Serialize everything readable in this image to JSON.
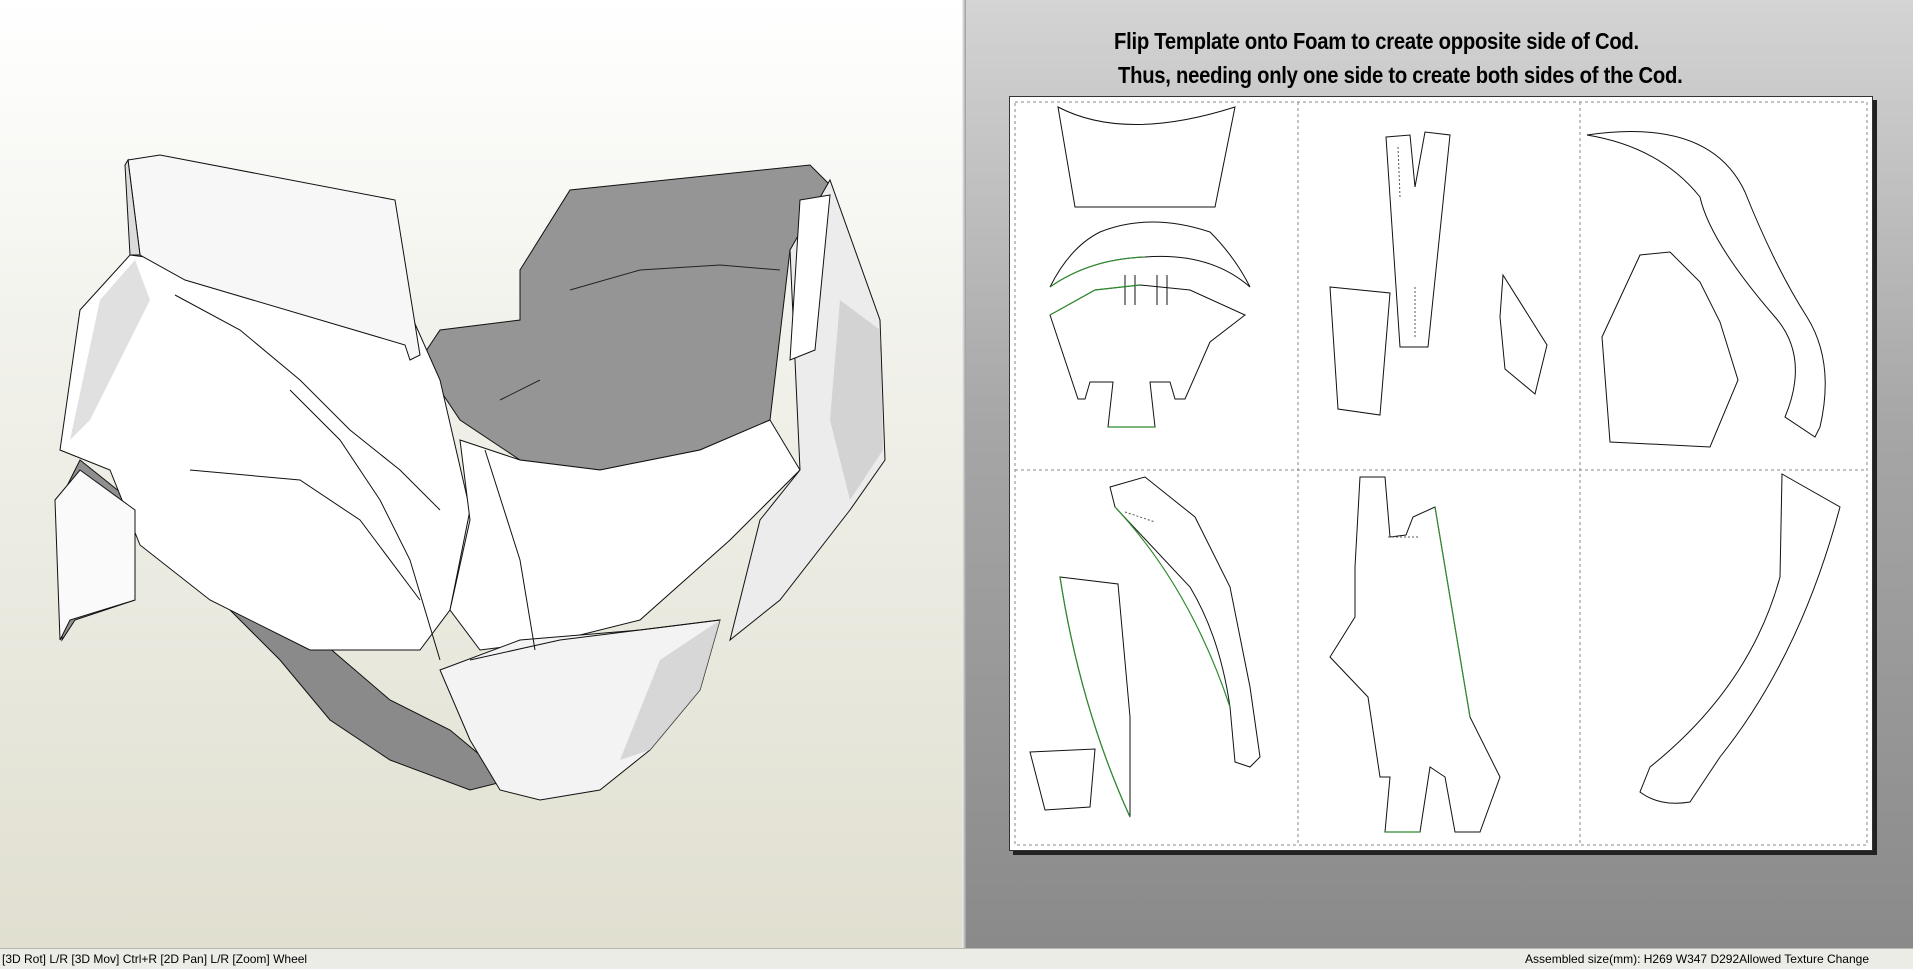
{
  "viewer3d": {
    "label": "3D view",
    "model": "armor-cod-model"
  },
  "viewer2d": {
    "note_line1": "Flip Template onto Foam to create opposite side of Cod.",
    "note_line2": "Thus, needing only one side to create both sides of the Cod."
  },
  "statusbar": {
    "controls": "[3D Rot] L/R [3D Mov] Ctrl+R [2D Pan] L/R [Zoom] Wheel",
    "info": "Assembled size(mm): H269 W347 D292Allowed Texture Change"
  },
  "colors": {
    "mesh_white": "#ffffff",
    "mesh_inner": "#959595",
    "fold_green": "#2e8b2e",
    "cut_line": "#000000"
  }
}
